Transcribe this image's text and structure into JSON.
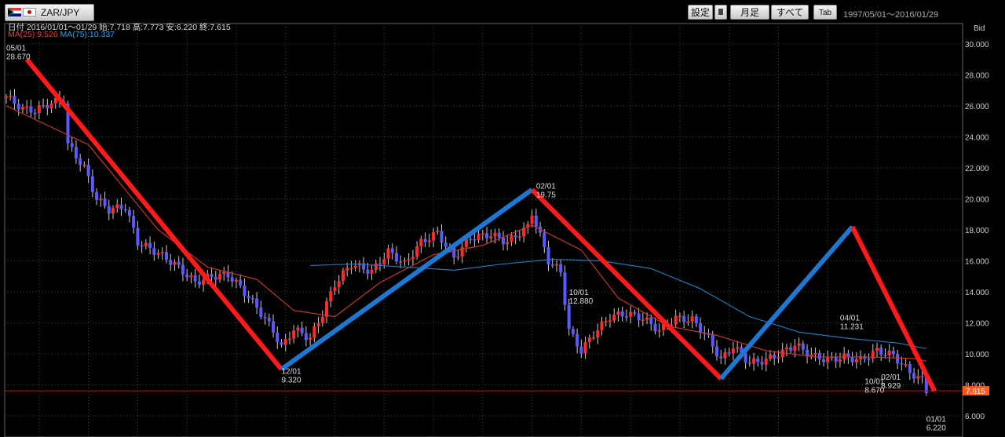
{
  "toolbar": {
    "pair": "ZAR/JPY",
    "settings_label": "設定",
    "monthly_label": "月足",
    "all_label": "すべて",
    "tab_label": "Tab",
    "range_label": "1997/05/01〜2016/01/29"
  },
  "info": {
    "ohlc_line": "日付 2016/01/01～01/29 始:7.718 高:7.773 安:6.220 終:7.615",
    "ma_short": "MA(25):9.526",
    "ma_long": "MA(75):10.337",
    "price_label": "Bid"
  },
  "colors": {
    "up_candle": "#ff2a2a",
    "down_candle": "#5a5aff",
    "ma_short": "#c0392b",
    "ma_long": "#1f78b4",
    "trend_down": "#ff1a1a",
    "trend_up": "#1e78d2",
    "current_price": "#ff5a1a"
  },
  "chart_data": {
    "type": "candlestick",
    "period": "monthly",
    "ylim": [
      6.0,
      30.0
    ],
    "y_ticks": [
      "30.000",
      "28.000",
      "26.000",
      "24.000",
      "22.000",
      "20.000",
      "18.000",
      "16.000",
      "14.000",
      "12.000",
      "10.000",
      "8.000",
      "6.000"
    ],
    "x_range": [
      "1997/05/01",
      "2016/01/29"
    ],
    "current_price": 7.615,
    "current_price_label": "7.615",
    "close_path": [
      [
        "1997-05",
        26.6
      ],
      [
        "1997-09",
        25.8
      ],
      [
        "1997-12",
        25.7
      ],
      [
        "1998-04",
        26.2
      ],
      [
        "1998-07",
        26.4
      ],
      [
        "1998-08",
        23.5
      ],
      [
        "1998-12",
        22.0
      ],
      [
        "1999-03",
        20.0
      ],
      [
        "1999-06",
        19.3
      ],
      [
        "1999-10",
        19.5
      ],
      [
        "2000-01",
        17.2
      ],
      [
        "2000-06",
        16.5
      ],
      [
        "2000-10",
        15.8
      ],
      [
        "2001-03",
        14.6
      ],
      [
        "2001-07",
        15.0
      ],
      [
        "2001-11",
        15.1
      ],
      [
        "2002-02",
        14.3
      ],
      [
        "2002-06",
        13.0
      ],
      [
        "2002-10",
        11.5
      ],
      [
        "2002-12",
        10.4
      ],
      [
        "2003-03",
        11.6
      ],
      [
        "2003-07",
        11.0
      ],
      [
        "2003-10",
        12.6
      ],
      [
        "2004-01",
        14.5
      ],
      [
        "2004-05",
        15.8
      ],
      [
        "2004-10",
        15.3
      ],
      [
        "2005-02",
        16.6
      ],
      [
        "2005-06",
        15.8
      ],
      [
        "2005-10",
        17.2
      ],
      [
        "2006-02",
        17.8
      ],
      [
        "2006-06",
        16.2
      ],
      [
        "2006-10",
        17.5
      ],
      [
        "2007-03",
        17.7
      ],
      [
        "2007-07",
        17.2
      ],
      [
        "2007-12",
        18.2
      ],
      [
        "2008-01",
        19.1
      ],
      [
        "2008-03",
        17.6
      ],
      [
        "2008-05",
        16.0
      ],
      [
        "2008-08",
        15.3
      ],
      [
        "2008-10",
        11.5
      ],
      [
        "2009-01",
        10.2
      ],
      [
        "2009-04",
        11.3
      ],
      [
        "2009-08",
        12.4
      ],
      [
        "2009-12",
        12.6
      ],
      [
        "2010-04",
        12.3
      ],
      [
        "2010-08",
        11.5
      ],
      [
        "2010-12",
        12.3
      ],
      [
        "2011-04",
        12.2
      ],
      [
        "2011-08",
        11.0
      ],
      [
        "2011-11",
        9.6
      ],
      [
        "2012-02",
        10.5
      ],
      [
        "2012-06",
        9.4
      ],
      [
        "2012-10",
        9.6
      ],
      [
        "2013-02",
        10.1
      ],
      [
        "2013-05",
        10.6
      ],
      [
        "2013-09",
        9.9
      ],
      [
        "2014-01",
        9.6
      ],
      [
        "2014-05",
        9.8
      ],
      [
        "2014-09",
        9.6
      ],
      [
        "2015-01",
        10.2
      ],
      [
        "2015-05",
        9.9
      ],
      [
        "2015-09",
        8.8
      ],
      [
        "2015-12",
        8.3
      ],
      [
        "2016-01",
        7.615
      ]
    ],
    "ma_short_path": [
      [
        "1997-05",
        26.0
      ],
      [
        "1999-01",
        23.5
      ],
      [
        "2000-06",
        18.0
      ],
      [
        "2001-06",
        15.6
      ],
      [
        "2002-06",
        14.8
      ],
      [
        "2003-03",
        12.8
      ],
      [
        "2004-01",
        12.4
      ],
      [
        "2004-12",
        14.6
      ],
      [
        "2006-01",
        16.4
      ],
      [
        "2007-01",
        17.0
      ],
      [
        "2008-01",
        18.3
      ],
      [
        "2009-01",
        16.7
      ],
      [
        "2009-10",
        13.6
      ],
      [
        "2010-10",
        11.8
      ],
      [
        "2011-10",
        11.2
      ],
      [
        "2012-10",
        10.2
      ],
      [
        "2013-10",
        9.8
      ],
      [
        "2014-10",
        9.8
      ],
      [
        "2015-10",
        9.7
      ],
      [
        "2016-01",
        9.526
      ]
    ],
    "ma_long_path": [
      [
        "2003-07",
        15.7
      ],
      [
        "2004-06",
        15.8
      ],
      [
        "2005-06",
        15.6
      ],
      [
        "2006-06",
        15.4
      ],
      [
        "2007-06",
        15.8
      ],
      [
        "2008-06",
        16.1
      ],
      [
        "2009-06",
        16.0
      ],
      [
        "2010-06",
        15.5
      ],
      [
        "2011-06",
        14.2
      ],
      [
        "2012-06",
        12.4
      ],
      [
        "2013-06",
        11.4
      ],
      [
        "2014-06",
        11.0
      ],
      [
        "2015-06",
        10.7
      ],
      [
        "2016-01",
        10.337
      ]
    ],
    "trend_lines": [
      {
        "dir": "down",
        "from": [
          "1997-10",
          29.0
        ],
        "to": [
          "2002-12",
          9.0
        ]
      },
      {
        "dir": "up",
        "from": [
          "2002-12",
          9.0
        ],
        "to": [
          "2008-01",
          20.6
        ]
      },
      {
        "dir": "down",
        "from": [
          "2008-01",
          20.6
        ],
        "to": [
          "2011-11",
          8.4
        ]
      },
      {
        "dir": "up",
        "from": [
          "2011-11",
          8.4
        ],
        "to": [
          "2014-07",
          18.2
        ]
      },
      {
        "dir": "down",
        "from": [
          "2014-07",
          18.2
        ],
        "to": [
          "2016-03",
          7.6
        ]
      }
    ],
    "annotations": [
      {
        "date": "05/01",
        "value": "28.670",
        "anchor": [
          "1997-05",
          28.67
        ],
        "place": "above"
      },
      {
        "date": "12/01",
        "value": "9.320",
        "anchor": [
          "2002-12",
          9.32
        ],
        "place": "below"
      },
      {
        "date": "02/01",
        "value": "19.75",
        "anchor": [
          "2008-02",
          19.75
        ],
        "place": "above"
      },
      {
        "date": "10/01",
        "value": "12.880",
        "anchor": [
          "2008-10",
          12.88
        ],
        "place": "above"
      },
      {
        "date": "10/01",
        "value": "8.670",
        "anchor": [
          "2014-10",
          8.67
        ],
        "place": "below"
      },
      {
        "date": "04/01",
        "value": "11.231",
        "anchor": [
          "2014-04",
          11.231
        ],
        "place": "above"
      },
      {
        "date": "02/01",
        "value": "8.929",
        "anchor": [
          "2015-02",
          8.929
        ],
        "place": "below"
      },
      {
        "date": "01/01",
        "value": "6.220",
        "anchor": [
          "2016-01",
          6.22
        ],
        "place": "below"
      }
    ]
  }
}
